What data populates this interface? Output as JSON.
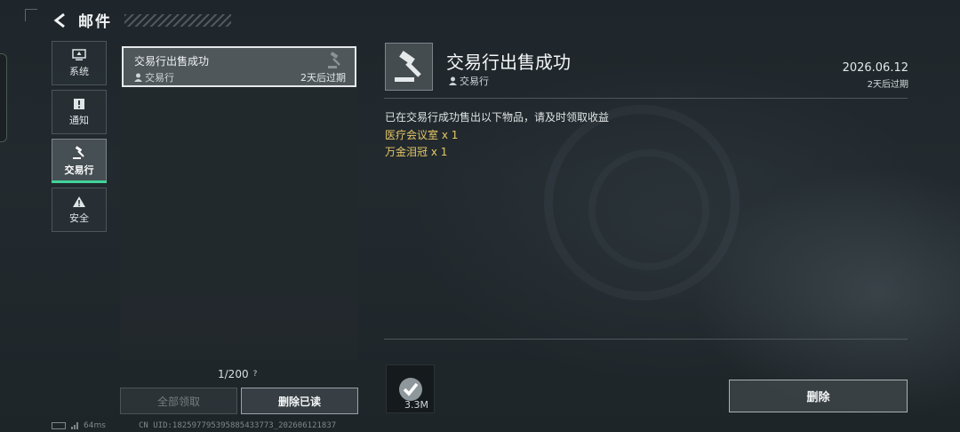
{
  "header": {
    "title": "邮件"
  },
  "sidebar": {
    "items": [
      {
        "label": "系统",
        "icon": "monitor-icon",
        "active": false
      },
      {
        "label": "通知",
        "icon": "notice-icon",
        "active": false
      },
      {
        "label": "交易行",
        "icon": "gavel-icon",
        "active": true
      },
      {
        "label": "安全",
        "icon": "warning-icon",
        "active": false
      }
    ]
  },
  "mail_list": {
    "items": [
      {
        "title": "交易行出售成功",
        "sender": "交易行",
        "expiry": "2天后过期"
      }
    ],
    "count": "1/200",
    "help": "?",
    "claim_all_label": "全部领取",
    "delete_read_label": "删除已读"
  },
  "detail": {
    "title": "交易行出售成功",
    "sender": "交易行",
    "date": "2026.06.12",
    "expiry": "2天后过期",
    "body": "已在交易行成功售出以下物品，请及时领取收益",
    "items": [
      "医疗会议室 x 1",
      "万金泪冠 x 1"
    ],
    "attachment_size": "3.3M",
    "delete_label": "删除"
  },
  "footer": {
    "ping": "64ms",
    "uid": "CN UID:182597795395885433773_202606121837"
  },
  "colors": {
    "accent": "#3fd49a",
    "item_highlight": "#e7c766"
  }
}
